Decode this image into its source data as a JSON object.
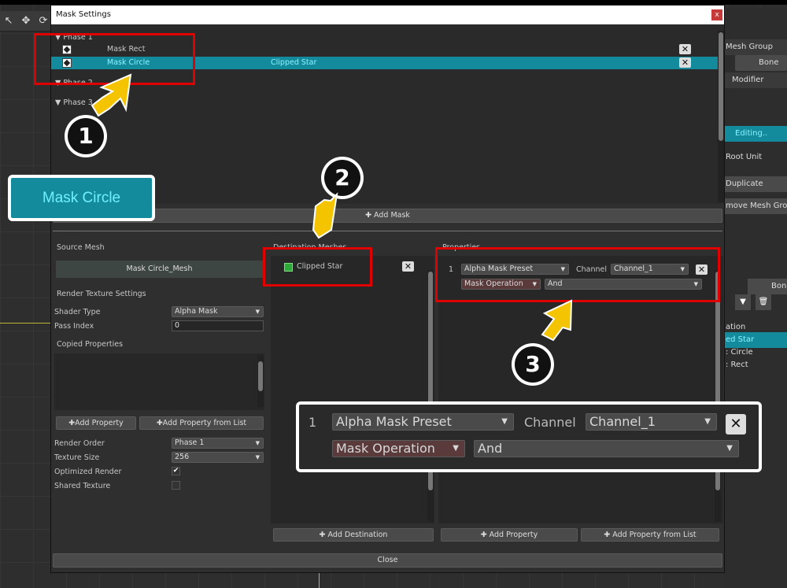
{
  "window_title": "Mask Settings",
  "close_glyph": "x",
  "phases": [
    "Phase 1",
    "Phase 2",
    "Phase 3"
  ],
  "masks": [
    {
      "name": "Mask Rect",
      "destination": ""
    },
    {
      "name": "Mask Circle",
      "destination": "Clipped Star"
    }
  ],
  "add_mask_label": "Add Mask",
  "source_mesh": {
    "section_label": "Source Mesh",
    "mesh_name": "Mask Circle_Mesh",
    "render_texture_label": "Render Texture Settings",
    "shader_type_label": "Shader Type",
    "shader_type_value": "Alpha Mask",
    "pass_index_label": "Pass Index",
    "pass_index_value": "0",
    "copied_properties_label": "Copied Properties",
    "add_property_label": "Add Property",
    "add_property_from_list_label": "Add Property from List",
    "render_order_label": "Render Order",
    "render_order_value": "Phase 1",
    "texture_size_label": "Texture Size",
    "texture_size_value": "256",
    "optimized_render_label": "Optimized Render",
    "optimized_render_checked": "✔",
    "shared_texture_label": "Shared Texture"
  },
  "destination": {
    "section_label": "Destination Meshes",
    "items": [
      "Clipped Star"
    ],
    "add_destination_label": "Add Destination"
  },
  "properties": {
    "section_label": "Properties",
    "index": "1",
    "preset_value": "Alpha Mask Preset",
    "channel_label": "Channel",
    "channel_value": "Channel_1",
    "operation_value": "Mask Operation",
    "operation_mode": "And",
    "add_property_label": "Add Property",
    "add_property_from_list_label": "Add Property from List"
  },
  "close_label": "Close",
  "callouts": {
    "zoom1_text": "Mask Circle",
    "step1": "1",
    "step2": "2",
    "step3": "3"
  },
  "right_panel": {
    "mesh_group_tab": "Mesh Group",
    "bone_tab": "Bone",
    "modifier_tab": "Modifier",
    "editing_label": "Editing..",
    "root_unit_label": "Root Unit",
    "duplicate_label": "Duplicate",
    "remove_mesh_group_label": "move Mesh Group",
    "bone_tab2": "Bone",
    "list": [
      "ation",
      "ed Star",
      ": Circle",
      ": Rect"
    ]
  },
  "colors": {
    "selection": "#138b9c",
    "callout_red": "#e00000",
    "arrow_yellow": "#f5c400"
  }
}
